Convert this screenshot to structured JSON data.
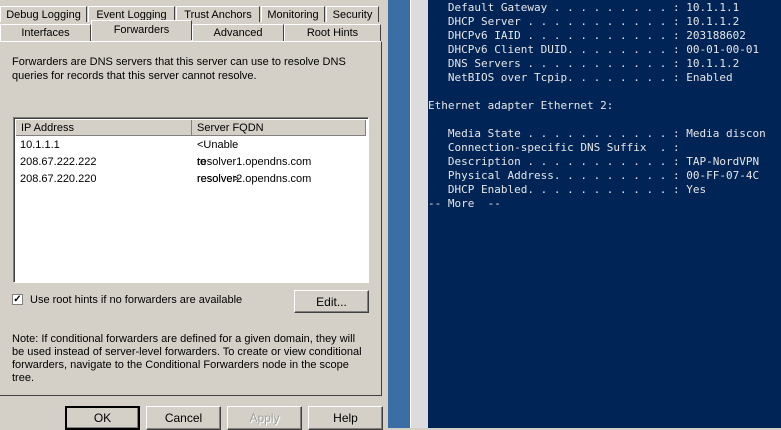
{
  "tabs_row1": [
    "Debug Logging",
    "Event Logging",
    "Trust Anchors",
    "Monitoring",
    "Security"
  ],
  "tabs_row2": [
    "Interfaces",
    "Forwarders",
    "Advanced",
    "Root Hints"
  ],
  "description": "Forwarders are DNS servers that this server can use to resolve DNS queries for records that this server cannot resolve.",
  "list": {
    "columns": [
      "IP Address",
      "Server FQDN"
    ],
    "rows": [
      [
        "10.1.1.1",
        "<Unable to resolve>"
      ],
      [
        "208.67.222.222",
        "resolver1.opendns.com"
      ],
      [
        "208.67.220.220",
        "resolver2.opendns.com"
      ]
    ]
  },
  "use_root_hints": {
    "label": "Use root hints if no forwarders are available",
    "checked": true
  },
  "edit_label": "Edit...",
  "note": "Note: If conditional forwarders are defined for a given domain, they will be used instead of server-level forwarders.  To create or view conditional forwarders, navigate to the Conditional Forwarders node in the scope tree.",
  "buttons": {
    "ok": "OK",
    "cancel": "Cancel",
    "apply": "Apply",
    "help": "Help"
  },
  "console_lines": [
    "   Default Gateway . . . . . . . . . : 10.1.1.1",
    "   DHCP Server . . . . . . . . . . . : 10.1.1.2",
    "   DHCPv6 IAID . . . . . . . . . . . : 203188602",
    "   DHCPv6 Client DUID. . . . . . . . : 00-01-00-01",
    "   DNS Servers . . . . . . . . . . . : 10.1.1.2",
    "   NetBIOS over Tcpip. . . . . . . . : Enabled",
    "",
    "Ethernet adapter Ethernet 2:",
    "",
    "   Media State . . . . . . . . . . . : Media discon",
    "   Connection-specific DNS Suffix  . :",
    "   Description . . . . . . . . . . . : TAP-NordVPN",
    "   Physical Address. . . . . . . . . : 00-FF-07-4C",
    "   DHCP Enabled. . . . . . . . . . . : Yes",
    "-- More  --"
  ]
}
